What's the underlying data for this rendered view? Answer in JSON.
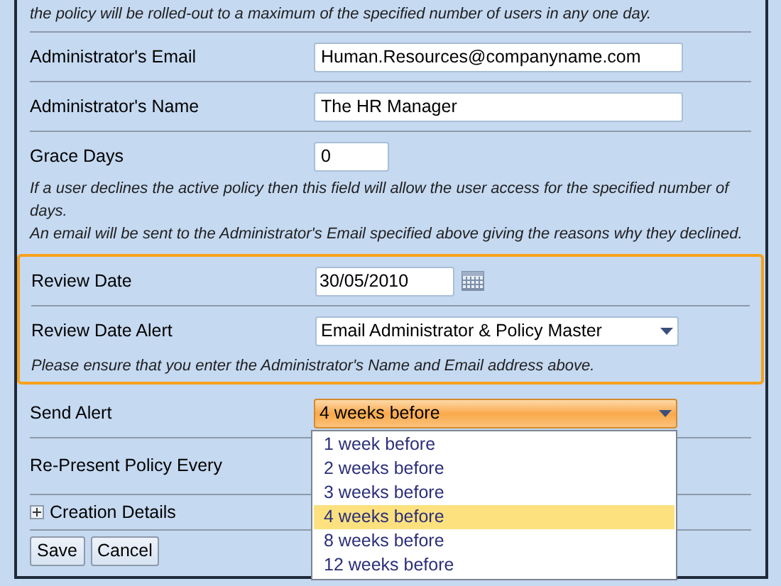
{
  "intro_note": "the policy will be rolled-out to a maximum of the specified number of users in any one day.",
  "fields": [
    {
      "label": "Administrator's Email",
      "kind": "text",
      "value": "Human.Resources@companyname.com"
    },
    {
      "label": "Administrator's Name",
      "kind": "text",
      "value": "The HR Manager"
    },
    {
      "label": "Grace Days",
      "kind": "short",
      "value": "0",
      "note": "If a user declines the active policy then this field will allow the user access for the specified number of days.\nAn email will be sent to the Administrator's Email specified above giving the reasons why they declined."
    }
  ],
  "highlight_group": {
    "fields": [
      {
        "label": "Review Date",
        "kind": "date",
        "value": "30/05/2010"
      },
      {
        "label": "Review Date Alert",
        "kind": "select",
        "value": "Email Administrator & Policy Master"
      }
    ],
    "note": "Please ensure that you enter the Administrator's Name and Email address above."
  },
  "send_alert": {
    "label": "Send Alert",
    "value": "4 weeks before",
    "expanded": true,
    "options": [
      {
        "label": "1 week before",
        "selected": false
      },
      {
        "label": "2 weeks before",
        "selected": false
      },
      {
        "label": "3 weeks before",
        "selected": false
      },
      {
        "label": "4 weeks before",
        "selected": true
      },
      {
        "label": "8 weeks before",
        "selected": false
      },
      {
        "label": "12 weeks before",
        "selected": false
      }
    ]
  },
  "re_present": {
    "label": "Re-Present Policy Every"
  },
  "creation_details": {
    "label": "Creation Details",
    "expanded": false
  },
  "buttons": [
    "Save",
    "Cancel"
  ]
}
